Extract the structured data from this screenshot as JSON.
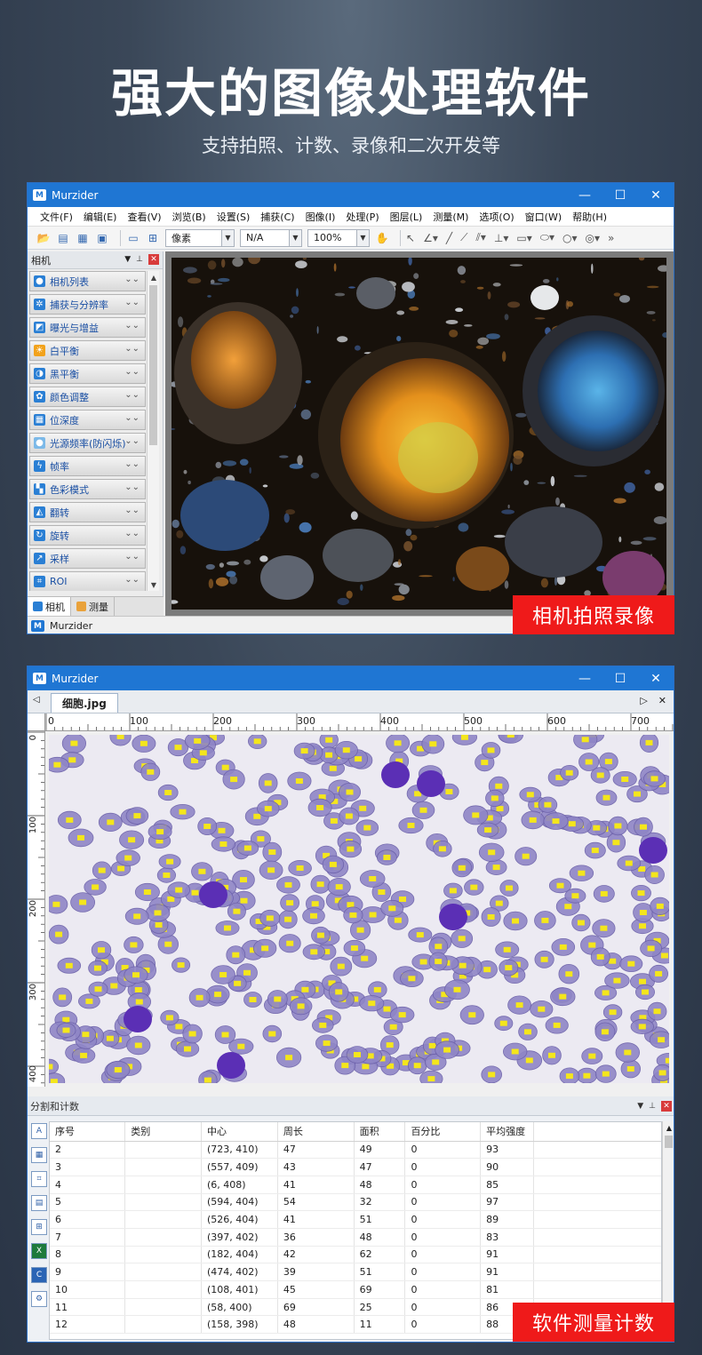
{
  "hero": {
    "title": "强大的图像处理软件",
    "subtitle": "支持拍照、计数、录像和二次开发等"
  },
  "window1": {
    "title": "Murzider",
    "logo_text": "M",
    "controls": [
      "—",
      "☐",
      "✕"
    ],
    "menu": [
      "文件(F)",
      "编辑(E)",
      "查看(V)",
      "浏览(B)",
      "设置(S)",
      "捕获(C)",
      "图像(I)",
      "处理(P)",
      "图层(L)",
      "测量(M)",
      "选项(O)",
      "窗口(W)",
      "帮助(H)"
    ],
    "toolbar": {
      "unit_select": "像素",
      "na_select": "N/A",
      "zoom_select": "100%"
    },
    "sidebar": {
      "title": "相机",
      "items": [
        {
          "label": "相机列表",
          "icon": "camera-icon"
        },
        {
          "label": "捕获与分辨率",
          "icon": "capture-icon"
        },
        {
          "label": "曝光与增益",
          "icon": "exposure-icon"
        },
        {
          "label": "白平衡",
          "icon": "sun-icon"
        },
        {
          "label": "黑平衡",
          "icon": "contrast-icon"
        },
        {
          "label": "颜色调整",
          "icon": "palette-icon"
        },
        {
          "label": "位深度",
          "icon": "bitdepth-icon"
        },
        {
          "label": "光源频率(防闪烁)",
          "icon": "bulb-icon"
        },
        {
          "label": "帧率",
          "icon": "framerate-icon"
        },
        {
          "label": "色彩模式",
          "icon": "colormode-icon"
        },
        {
          "label": "翻转",
          "icon": "flip-icon"
        },
        {
          "label": "旋转",
          "icon": "rotate-icon"
        },
        {
          "label": "采样",
          "icon": "sampling-icon"
        },
        {
          "label": "ROI",
          "icon": "roi-icon"
        }
      ],
      "tabs": [
        "相机",
        "测量"
      ]
    },
    "status": "Murzider"
  },
  "badge1": "相机拍照录像",
  "window2": {
    "title": "Murzider",
    "doc_tab": "细胞.jpg",
    "ruler_h": [
      "0",
      "100",
      "200",
      "300",
      "400",
      "500",
      "600",
      "700"
    ],
    "ruler_v": [
      "0",
      "100",
      "200",
      "300",
      "400"
    ],
    "panel": {
      "title": "分割和计数",
      "columns": [
        "序号",
        "类别",
        "中心",
        "周长",
        "面积",
        "百分比",
        "平均强度"
      ],
      "rows": [
        [
          "2",
          "",
          "(723, 410)",
          "47",
          "49",
          "0",
          "93"
        ],
        [
          "3",
          "",
          "(557, 409)",
          "43",
          "47",
          "0",
          "90"
        ],
        [
          "4",
          "",
          "(6, 408)",
          "41",
          "48",
          "0",
          "85"
        ],
        [
          "5",
          "",
          "(594, 404)",
          "54",
          "32",
          "0",
          "97"
        ],
        [
          "6",
          "",
          "(526, 404)",
          "41",
          "51",
          "0",
          "89"
        ],
        [
          "7",
          "",
          "(397, 402)",
          "36",
          "48",
          "0",
          "83"
        ],
        [
          "8",
          "",
          "(182, 404)",
          "42",
          "62",
          "0",
          "91"
        ],
        [
          "9",
          "",
          "(474, 402)",
          "39",
          "51",
          "0",
          "91"
        ],
        [
          "10",
          "",
          "(108, 401)",
          "45",
          "69",
          "0",
          "81"
        ],
        [
          "11",
          "",
          "(58, 400)",
          "69",
          "25",
          "0",
          "86"
        ],
        [
          "12",
          "",
          "(158, 398)",
          "48",
          "11",
          "0",
          "88"
        ]
      ]
    }
  },
  "badge2": "软件测量计数",
  "colors": {
    "accent_blue": "#1f76d3",
    "badge_red": "#ef1a1a"
  }
}
